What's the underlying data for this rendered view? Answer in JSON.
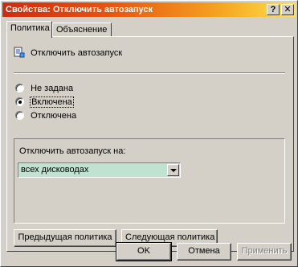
{
  "window": {
    "title": "Свойства: Отключить автозапуск",
    "help_glyph": "?",
    "close_glyph": "✕"
  },
  "tabs": [
    {
      "label": "Политика",
      "active": true
    },
    {
      "label": "Объяснение",
      "active": false
    }
  ],
  "policy": {
    "icon": "policy-setting-icon",
    "name": "Отключить автозапуск"
  },
  "radios": [
    {
      "label": "Не задана",
      "selected": false
    },
    {
      "label": "Включена",
      "selected": true
    },
    {
      "label": "Отключена",
      "selected": false
    }
  ],
  "options": {
    "label": "Отключить автозапуск на:",
    "combo_value": "всех дисководах"
  },
  "nav": {
    "prev_label": "Предыдущая политика",
    "next_label": "Следующая политика"
  },
  "buttons": {
    "ok": "OK",
    "cancel": "Отмена",
    "apply": "Применить"
  },
  "colors": {
    "title_gradient_start": "#cf2a0f",
    "title_gradient_end": "#ffe34d",
    "combo_bg": "#bfe3d0",
    "face": "#d4d0c8"
  }
}
